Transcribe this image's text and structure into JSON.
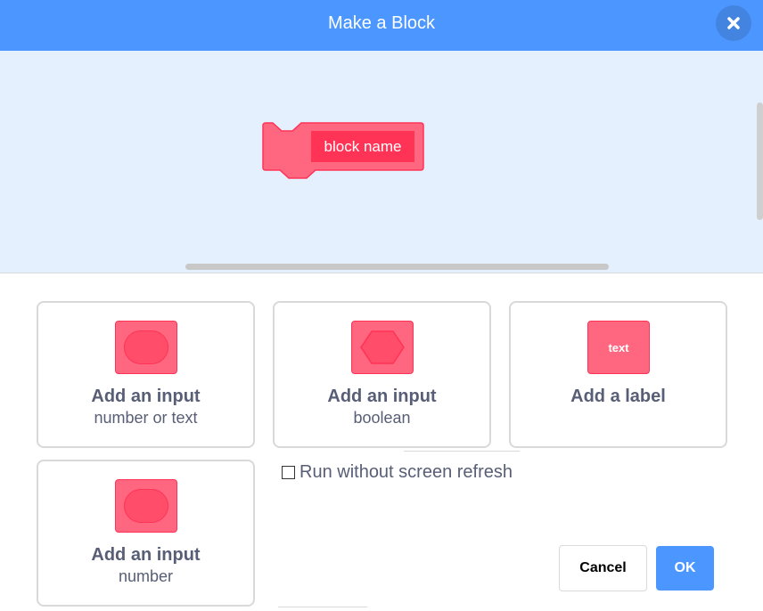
{
  "dialog": {
    "title": "Make a Block",
    "close_icon": "close-icon"
  },
  "preview": {
    "block_name": "block name",
    "block_color": "#ff6680",
    "field_color": "#ff3355"
  },
  "options": [
    {
      "title": "Add an input",
      "subtitle": "number or text",
      "icon": "oval-input-icon"
    },
    {
      "title": "Add an input",
      "subtitle": "boolean",
      "icon": "boolean-input-icon"
    },
    {
      "title": "Add a label",
      "subtitle": "",
      "icon": "text-label-icon",
      "icon_text": "text"
    },
    {
      "title": "Add an input",
      "subtitle": "number",
      "icon": "oval-input-icon"
    }
  ],
  "run_without_refresh": {
    "label": "Run without screen refresh",
    "checked": false
  },
  "buttons": {
    "cancel": "Cancel",
    "ok": "OK"
  },
  "colors": {
    "accent": "#4c97ff",
    "workspace": "#e5f0ff",
    "text": "#575e75"
  }
}
